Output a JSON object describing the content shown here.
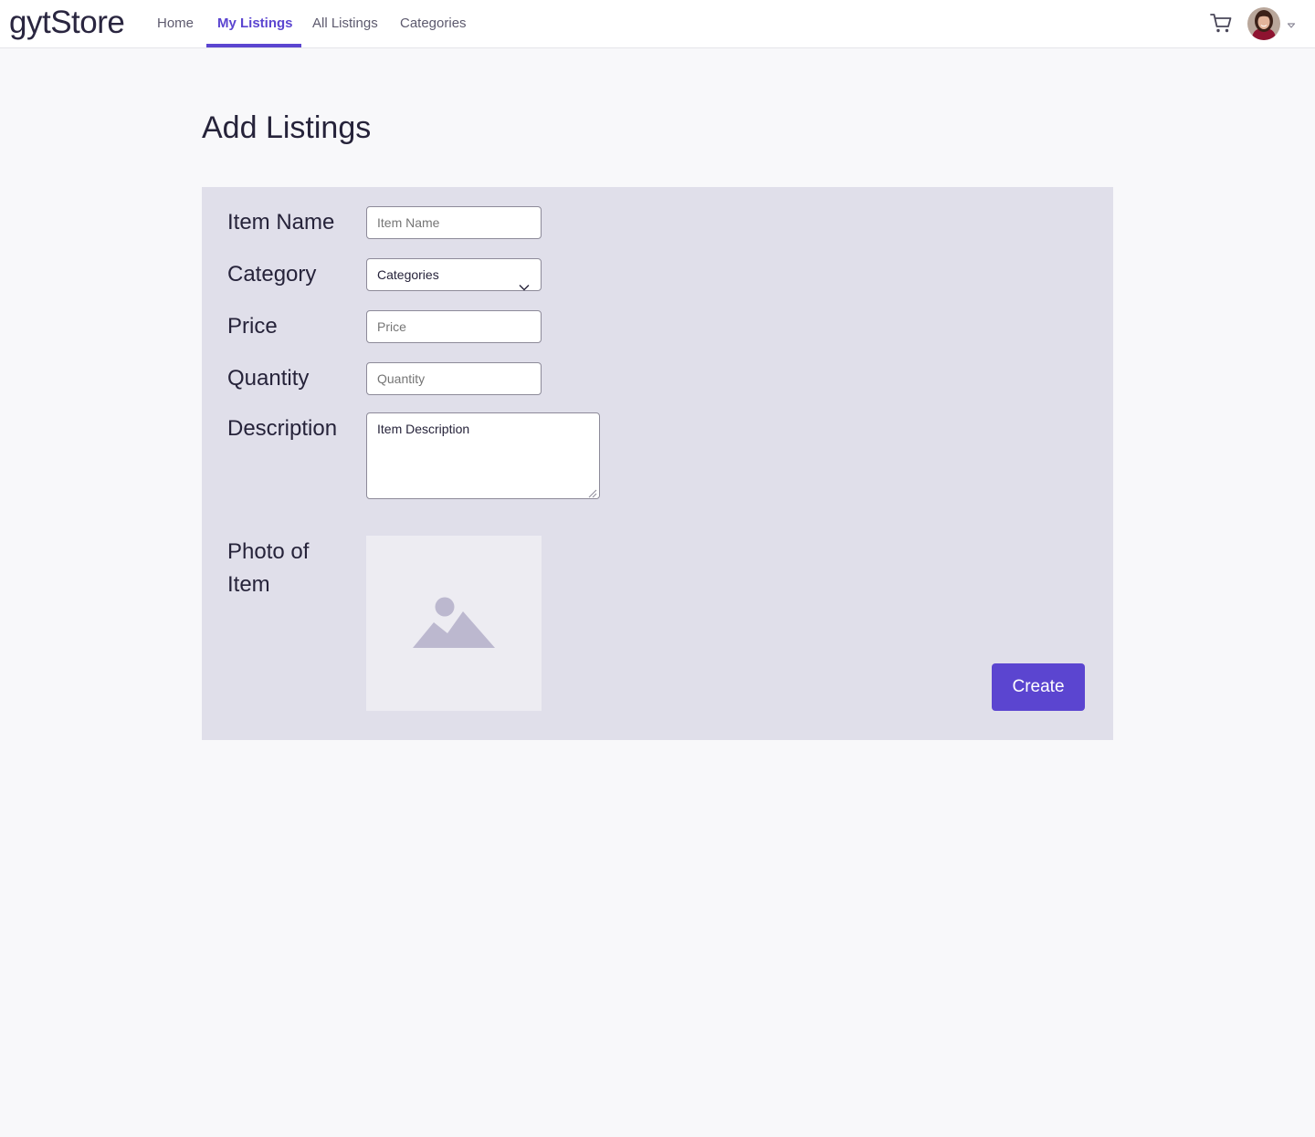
{
  "app": {
    "brand": "gytStore"
  },
  "nav": {
    "items": [
      {
        "label": "Home",
        "active": false
      },
      {
        "label": "My Listings",
        "active": true
      },
      {
        "label": "All Listings",
        "active": false
      },
      {
        "label": "Categories",
        "active": false
      }
    ],
    "cart_icon": "shopping-cart-icon",
    "avatar_icon": "user-avatar",
    "menu_icon": "caret-down-icon"
  },
  "page": {
    "title": "Add Listings"
  },
  "form": {
    "item_name": {
      "label": "Item Name",
      "placeholder": "Item Name",
      "value": ""
    },
    "category": {
      "label": "Category",
      "selected": "Categories"
    },
    "price": {
      "label": "Price",
      "placeholder": "Price",
      "value": ""
    },
    "quantity": {
      "label": "Quantity",
      "placeholder": "Quantity",
      "value": ""
    },
    "description": {
      "label": "Description",
      "placeholder": "Item Description",
      "value": ""
    },
    "photo": {
      "label_line1": "Photo of",
      "label_line2": "Item",
      "icon": "image-placeholder-icon"
    },
    "submit_label": "Create"
  },
  "colors": {
    "accent": "#5b45d0",
    "panel_bg": "#e0dfea",
    "page_bg": "#f8f8fa",
    "text": "#26233a"
  }
}
